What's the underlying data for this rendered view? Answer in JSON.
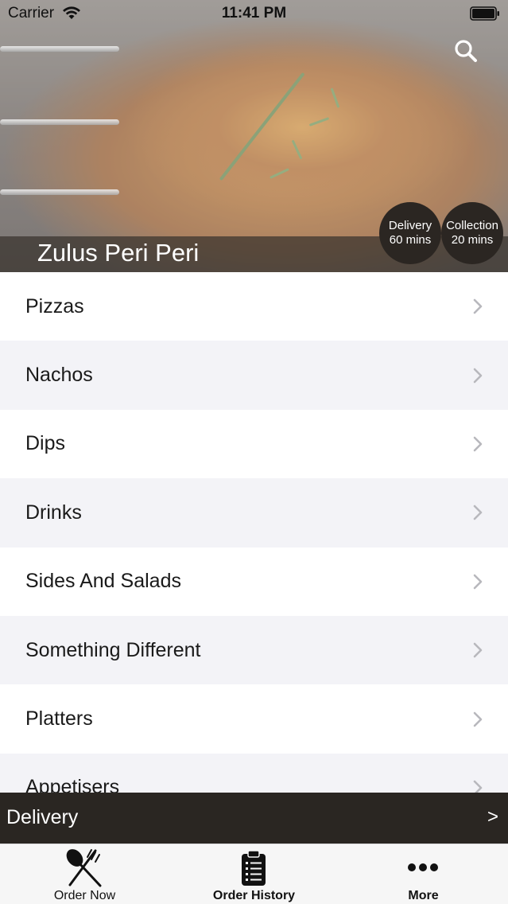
{
  "status_bar": {
    "carrier": "Carrier",
    "time": "11:41 PM"
  },
  "hero": {
    "restaurant_name": "Zulus Peri Peri",
    "delivery_badge": {
      "line1": "Delivery",
      "line2": "60 mins"
    },
    "collection_badge": {
      "line1": "Collection",
      "line2": "20 mins"
    },
    "search_icon": "search-icon"
  },
  "categories": [
    {
      "label": "Pizzas"
    },
    {
      "label": "Nachos"
    },
    {
      "label": "Dips"
    },
    {
      "label": "Drinks"
    },
    {
      "label": "Sides And Salads"
    },
    {
      "label": "Something Different"
    },
    {
      "label": "Platters"
    },
    {
      "label": "Appetisers"
    }
  ],
  "delivery_bar": {
    "label": "Delivery",
    "arrow": ">"
  },
  "tab_bar": {
    "tabs": [
      {
        "label": "Order Now",
        "icon": "fork-knife-icon"
      },
      {
        "label": "Order History",
        "icon": "clipboard-icon"
      },
      {
        "label": "More",
        "icon": "more-dots-icon"
      }
    ]
  },
  "colors": {
    "dark_bar": "#2a2622",
    "row_alt": "#f3f3f7",
    "badge": "#2b2622"
  }
}
